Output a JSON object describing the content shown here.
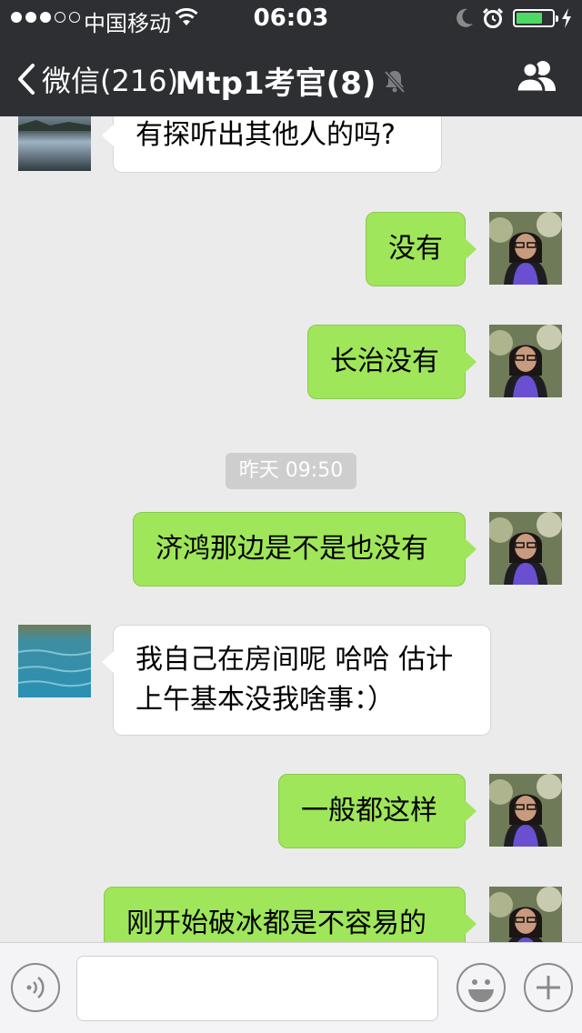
{
  "status_bar": {
    "carrier": "中国移动",
    "time": "06:03"
  },
  "nav": {
    "back_label": "微信(216)",
    "title": "Mtp1考官(8)"
  },
  "messages": [
    {
      "side": "left",
      "text": "有探听出其他人的吗?"
    },
    {
      "side": "right",
      "text": "没有"
    },
    {
      "side": "right",
      "text": "长治没有"
    },
    {
      "side": "right",
      "text": "济鸿那边是不是也没有"
    },
    {
      "side": "left",
      "text": "我自己在房间呢 哈哈 估计上午基本没我啥事：）",
      "lines": [
        "我自己在房间呢 哈哈 估计",
        "上午基本没我啥事：）"
      ]
    },
    {
      "side": "right",
      "text": "一般都这样"
    },
    {
      "side": "right",
      "text": "刚开始破冰都是不容易的"
    }
  ],
  "timestamp": "昨天 09:50",
  "input": {
    "value": ""
  },
  "colors": {
    "header_bg": "#2e2f33",
    "chat_bg": "#ebebeb",
    "bubble_green": "#9fe65a",
    "bubble_white": "#ffffff"
  }
}
